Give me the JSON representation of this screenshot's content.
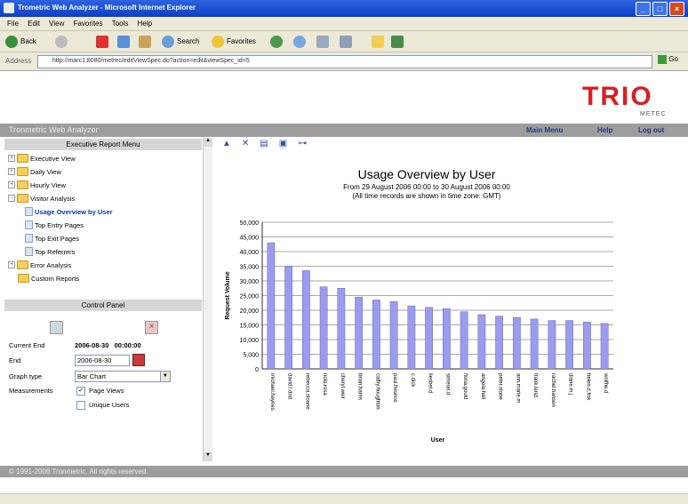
{
  "window": {
    "title": "Trometric Web Analyzer - Microsoft Internet Explorer"
  },
  "menus": [
    "File",
    "Edit",
    "View",
    "Favorites",
    "Tools",
    "Help"
  ],
  "toolbar": {
    "back": "Back",
    "search": "Search",
    "favorites": "Favorites"
  },
  "address": {
    "label": "Address",
    "url": "http://marc1:8080/metrec/editViewSpec.do?action=edit&viewSpec_id=5",
    "go": "Go"
  },
  "header": {
    "logo": "TRIO",
    "logo_sub": "METEC"
  },
  "appbar": {
    "title": "Tronmetric Web Analyzer",
    "main_menu": "Main Menu",
    "help": "Help",
    "logout": "Log out"
  },
  "menu_panel": {
    "title": "Executive Report Menu",
    "items": [
      {
        "label": "Executive View"
      },
      {
        "label": "Daily View"
      },
      {
        "label": "Hourly View"
      },
      {
        "label": "Visitor Analysis"
      },
      {
        "label": "Usage Overview by User"
      },
      {
        "label": "Top Entry Pages"
      },
      {
        "label": "Top Exit Pages"
      },
      {
        "label": "Top Referrers"
      },
      {
        "label": "Error Analysis"
      },
      {
        "label": "Custom Reports"
      }
    ]
  },
  "control_panel": {
    "title": "Control Panel",
    "current_end_label": "Current End",
    "current_end_value": "2006-08-30   00:00:00",
    "end_label": "End",
    "end_value": "2006-08-30",
    "graph_type_label": "Graph type",
    "graph_type_value": "Bar Chart",
    "measurements_label": "Measurements",
    "page_views": "Page Views",
    "unique_users": "Unique Users"
  },
  "report": {
    "sub1": "From 29 August 2006 00:00 to 30 August 2006 00:00",
    "sub2": "(All time records are shown in time zone: GMT)"
  },
  "chart_data": {
    "type": "bar",
    "title": "Usage Overview by User",
    "xlabel": "User",
    "ylabel": "Request Volume",
    "ylim": [
      0,
      50000
    ],
    "yticks": [
      "0",
      "5,000",
      "10,000",
      "15,000",
      "20,000",
      "25,000",
      "30,000",
      "35,000",
      "40,000",
      "45,000",
      "50,000"
    ],
    "grid": true,
    "bar_color": "#9b9bef",
    "categories": [
      "michael.haynes",
      "david.l.dod",
      "rebecca.sloane",
      "nola.rosa",
      "cheryl.weir",
      "brian.harris",
      "cathy.houghton",
      "paul.fresnos",
      "c.dick",
      "liesbet.d",
      "simeon.d",
      "fiona.gould",
      "angela.hall",
      "peter.stone",
      "ann.marie.m",
      "frank.lenzi",
      "rachel.hansen",
      "diane.m.j",
      "helen.d.fisk",
      "wolfhe.d"
    ],
    "values": [
      43000,
      35000,
      33500,
      28000,
      27500,
      24500,
      23500,
      23000,
      21500,
      21000,
      20500,
      19500,
      18500,
      18000,
      17500,
      17000,
      16500,
      16500,
      16000,
      15500
    ]
  },
  "footer": {
    "copyright": "© 1991-2006 Tronmetric. All rights reserved."
  }
}
